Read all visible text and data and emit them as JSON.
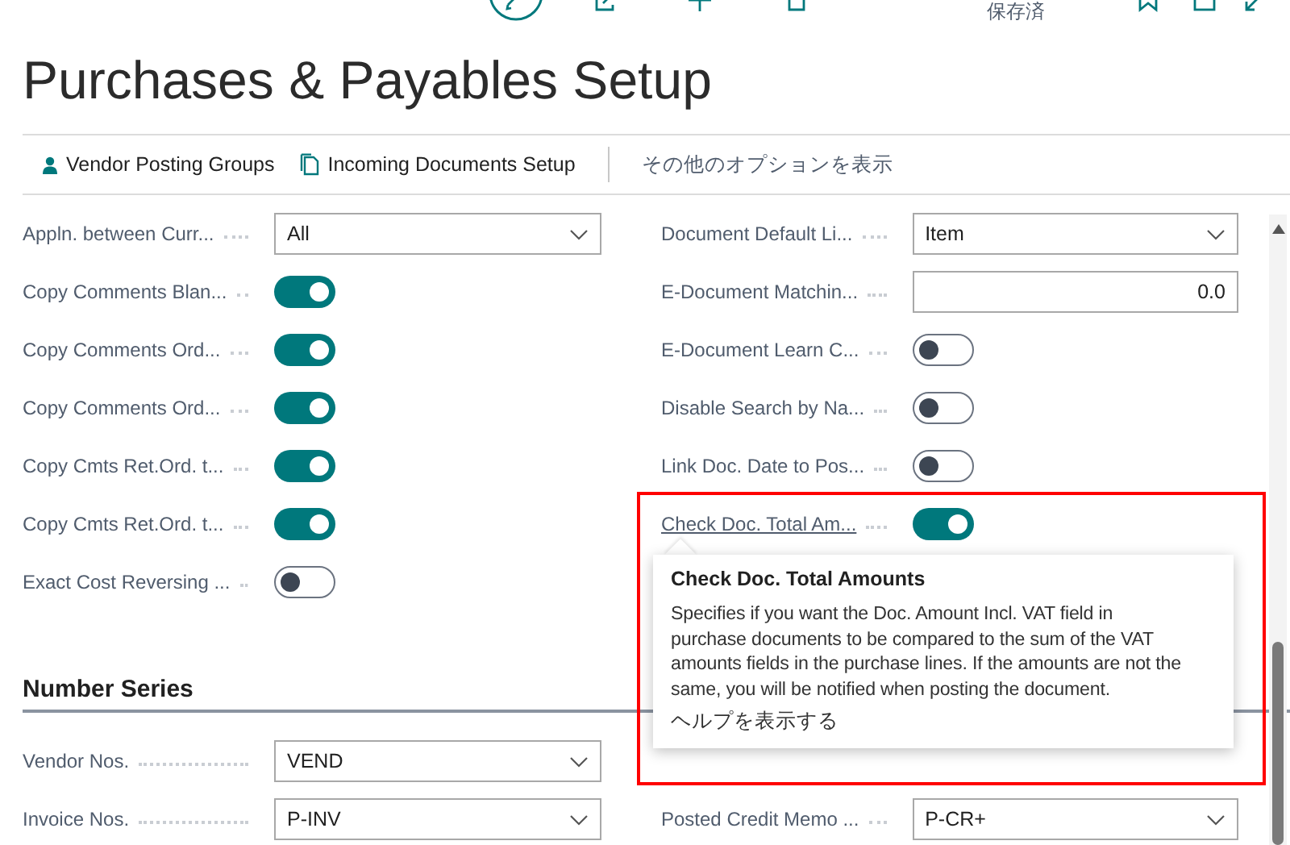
{
  "toolbar": {
    "status": "保存済"
  },
  "title": "Purchases & Payables Setup",
  "actions": [
    {
      "label": "Vendor Posting Groups"
    },
    {
      "label": "Incoming Documents Setup"
    }
  ],
  "more_options": "その他のオプションを表示",
  "general": {
    "left": [
      {
        "kind": "select",
        "label": "Appln. between Curr...",
        "value": "All"
      },
      {
        "kind": "toggle",
        "label": "Copy Comments Blan...",
        "on": true
      },
      {
        "kind": "toggle",
        "label": "Copy Comments Ord...",
        "on": true
      },
      {
        "kind": "toggle",
        "label": "Copy Comments Ord...",
        "on": true
      },
      {
        "kind": "toggle",
        "label": "Copy Cmts Ret.Ord. t...",
        "on": true
      },
      {
        "kind": "toggle",
        "label": "Copy Cmts Ret.Ord. t...",
        "on": true
      },
      {
        "kind": "toggle",
        "label": "Exact Cost Reversing ...",
        "on": false
      }
    ],
    "right": [
      {
        "kind": "select",
        "label": "Document Default Li...",
        "value": "Item"
      },
      {
        "kind": "number",
        "label": "E-Document Matchin...",
        "value": "0.0"
      },
      {
        "kind": "toggle",
        "label": "E-Document Learn C...",
        "on": false
      },
      {
        "kind": "toggle",
        "label": "Disable Search by Na...",
        "on": false
      },
      {
        "kind": "toggle",
        "label": "Link Doc. Date to Pos...",
        "on": false
      },
      {
        "kind": "toggle",
        "label": "Check Doc. Total Am...",
        "on": true,
        "link": true
      }
    ]
  },
  "number_series": {
    "heading": "Number Series",
    "left": [
      {
        "kind": "select",
        "label": "Vendor Nos.",
        "value": "VEND"
      },
      {
        "kind": "select",
        "label": "Invoice Nos.",
        "value": "P-INV"
      }
    ],
    "right": [
      {
        "kind": "select",
        "label": "Posted Credit Memo ...",
        "value": "P-CR+"
      }
    ]
  },
  "tooltip": {
    "title": "Check Doc. Total Amounts",
    "body": "Specifies if you want the Doc. Amount Incl. VAT field in purchase documents to be compared to the sum of the VAT amounts fields in the purchase lines. If the amounts are not the same, you will be notified when posting the document.",
    "help_link": "ヘルプを表示する"
  }
}
